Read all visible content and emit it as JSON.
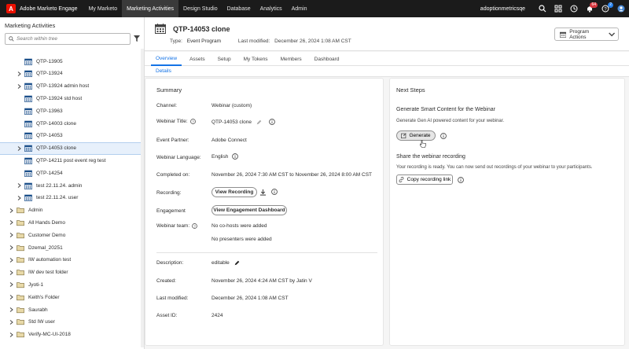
{
  "topbar": {
    "app_name": "Adobe Marketo Engage",
    "nav": [
      "My Marketo",
      "Marketing Activities",
      "Design Studio",
      "Database",
      "Analytics",
      "Admin"
    ],
    "active_nav": "Marketing Activities",
    "user": "adoptionmetricsqe",
    "notifications_badge": "64",
    "help_badge": "2"
  },
  "sidebar": {
    "title": "Marketing Activities",
    "search_placeholder": "Search within tree",
    "items": [
      {
        "label": "QTP-13905",
        "type": "program",
        "indent": 1,
        "chevron": false
      },
      {
        "label": "QTP-13924",
        "type": "program",
        "indent": 1,
        "chevron": true
      },
      {
        "label": "QTP-13924 admin host",
        "type": "program",
        "indent": 1,
        "chevron": true
      },
      {
        "label": "QTP-13924 std host",
        "type": "program",
        "indent": 1,
        "chevron": false
      },
      {
        "label": "QTP-13963",
        "type": "program",
        "indent": 1,
        "chevron": false
      },
      {
        "label": "QTP-14003 clone",
        "type": "program",
        "indent": 1,
        "chevron": false
      },
      {
        "label": "QTP-14053",
        "type": "program",
        "indent": 1,
        "chevron": false
      },
      {
        "label": "QTP-14053 clone",
        "type": "program",
        "indent": 1,
        "chevron": true,
        "selected": true
      },
      {
        "label": "QTP-14211 post event reg test",
        "type": "program",
        "indent": 1,
        "chevron": false
      },
      {
        "label": "QTP-14254",
        "type": "program",
        "indent": 1,
        "chevron": false
      },
      {
        "label": "test 22.11.24. admin",
        "type": "program",
        "indent": 1,
        "chevron": true
      },
      {
        "label": "test 22.11.24. user",
        "type": "program",
        "indent": 1,
        "chevron": true
      },
      {
        "label": "Admin",
        "type": "folder",
        "indent": 0,
        "chevron": true
      },
      {
        "label": "All Hands Demo",
        "type": "folder",
        "indent": 0,
        "chevron": true
      },
      {
        "label": "Customer Demo",
        "type": "folder",
        "indent": 0,
        "chevron": true
      },
      {
        "label": "Dzemal_20251",
        "type": "folder",
        "indent": 0,
        "chevron": true
      },
      {
        "label": "IW automation test",
        "type": "folder",
        "indent": 0,
        "chevron": true
      },
      {
        "label": "IW dev test folder",
        "type": "folder",
        "indent": 0,
        "chevron": true
      },
      {
        "label": "Jyoti-1",
        "type": "folder",
        "indent": 0,
        "chevron": true
      },
      {
        "label": "Keith's Folder",
        "type": "folder",
        "indent": 0,
        "chevron": true
      },
      {
        "label": "Saurabh",
        "type": "folder",
        "indent": 0,
        "chevron": true
      },
      {
        "label": "Std IW user",
        "type": "folder",
        "indent": 0,
        "chevron": true
      },
      {
        "label": "Verify-MC-UI-2018",
        "type": "folder",
        "indent": 0,
        "chevron": true
      }
    ]
  },
  "header": {
    "title": "QTP-14053 clone",
    "type_label": "Type:",
    "type_value": "Event Program",
    "modified_label": "Last modified:",
    "modified_value": "December 26, 2024 1:08 AM CST",
    "actions_button": "Program Actions"
  },
  "tabs": [
    "Overview",
    "Assets",
    "Setup",
    "My Tokens",
    "Members",
    "Dashboard"
  ],
  "active_tab": "Overview",
  "subtab": "Details",
  "summary": {
    "title": "Summary",
    "channel_label": "Channel:",
    "channel_value": "Webinar (custom)",
    "webinar_title_label": "Webinar Title:",
    "webinar_title_value": "QTP-14053 clone",
    "event_partner_label": "Event Partner:",
    "event_partner_value": "Adobe Connect",
    "language_label": "Webinar Language:",
    "language_value": "English",
    "completed_label": "Completed on:",
    "completed_value": "November 26, 2024 7:30 AM CST to November 26, 2024 8:00 AM CST",
    "recording_label": "Recording:",
    "view_recording": "View Recording",
    "engagement_label": "Engagement",
    "view_engagement": "View Engagement Dashboard",
    "team_label": "Webinar team:",
    "no_cohosts": "No co-hosts were added",
    "no_presenters": "No presenters were added",
    "description_label": "Description:",
    "description_value": "editable",
    "created_label": "Created:",
    "created_value": "November 26, 2024 4:24 AM CST by Jatin V",
    "last_modified_label": "Last modified:",
    "last_modified_value": "December 26, 2024 1:08 AM CST",
    "asset_id_label": "Asset ID:",
    "asset_id_value": "2424"
  },
  "next_steps": {
    "title": "Next Steps",
    "smart_title": "Generate Smart Content for the Webinar",
    "smart_desc": "Generate Gen AI powered content for your webinar.",
    "generate_button": "Generate",
    "share_title": "Share the webinar recording",
    "share_desc": "Your recording is ready. You can now send out recordings of your webinar to your participants.",
    "copy_button": "Copy recording link"
  },
  "colors": {
    "accent": "#1473e6",
    "topbar": "#1b1b1b",
    "brand": "#eb1000"
  }
}
